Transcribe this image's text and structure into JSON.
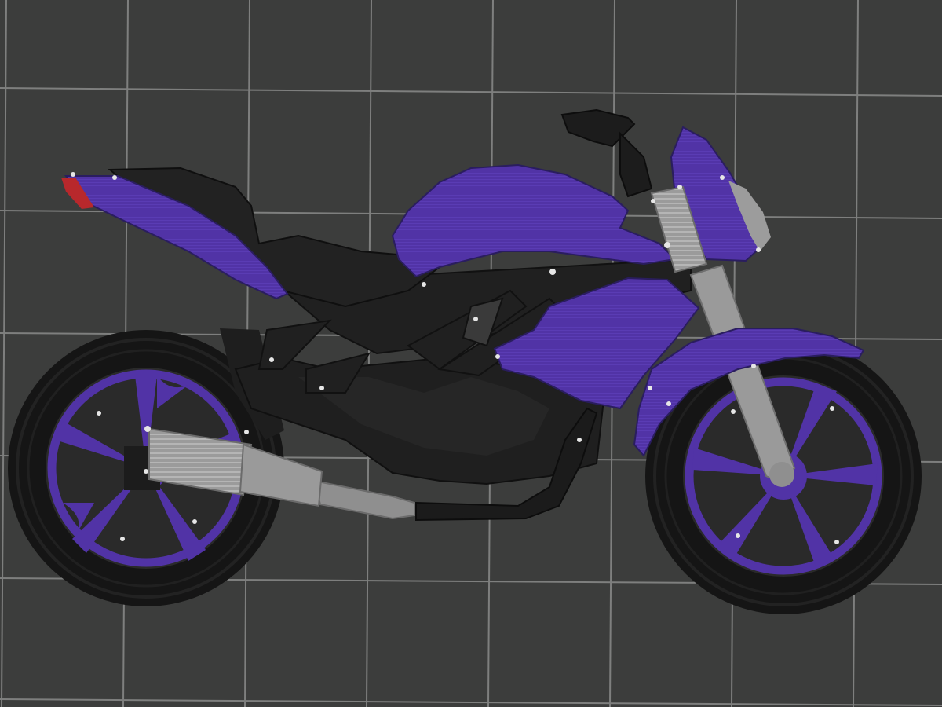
{
  "scene": {
    "view": "side",
    "object": "motorcycle",
    "grid": true
  },
  "colors": {
    "background": "#3c3d3c",
    "grid_line": "#8a8b8a",
    "body_primary": "#5133a6",
    "body_primary_light": "#5f3fbb",
    "frame_dark": "#1f1f1f",
    "frame_mid": "#2a2a2a",
    "tire": "#161616",
    "metal": "#9a9a9a",
    "metal_dark": "#7d7d7d",
    "tail_light": "#b8282c",
    "screw": "#e6e6e6"
  }
}
